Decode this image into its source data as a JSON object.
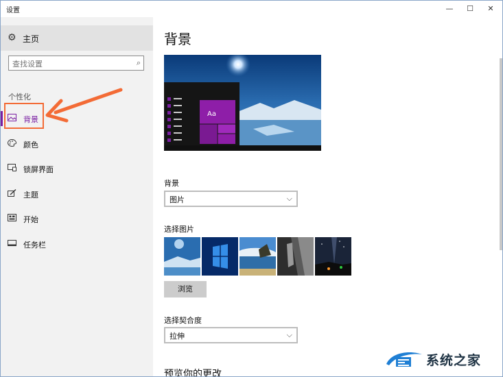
{
  "window": {
    "title": "设置",
    "minimize": "—",
    "maximize": "☐",
    "close": "✕"
  },
  "sidebar": {
    "home_label": "主页",
    "search_placeholder": "查找设置",
    "section_label": "个性化",
    "items": [
      {
        "label": "背景",
        "icon": "picture-icon",
        "active": true
      },
      {
        "label": "颜色",
        "icon": "palette-icon"
      },
      {
        "label": "锁屏界面",
        "icon": "lock-screen-icon"
      },
      {
        "label": "主题",
        "icon": "theme-brush-icon"
      },
      {
        "label": "开始",
        "icon": "start-icon"
      },
      {
        "label": "任务栏",
        "icon": "taskbar-icon"
      }
    ]
  },
  "main": {
    "title": "背景",
    "preview_tile_text": "Aa",
    "background_label": "背景",
    "background_value": "图片",
    "choose_picture_label": "选择图片",
    "browse_label": "浏览",
    "fit_label": "选择契合度",
    "fit_value": "拉伸",
    "preview_changes_label": "预览你的更改"
  },
  "watermark": {
    "text": "系统之家"
  },
  "colors": {
    "accent": "#7a1fa2",
    "annotation": "#f36b36"
  }
}
